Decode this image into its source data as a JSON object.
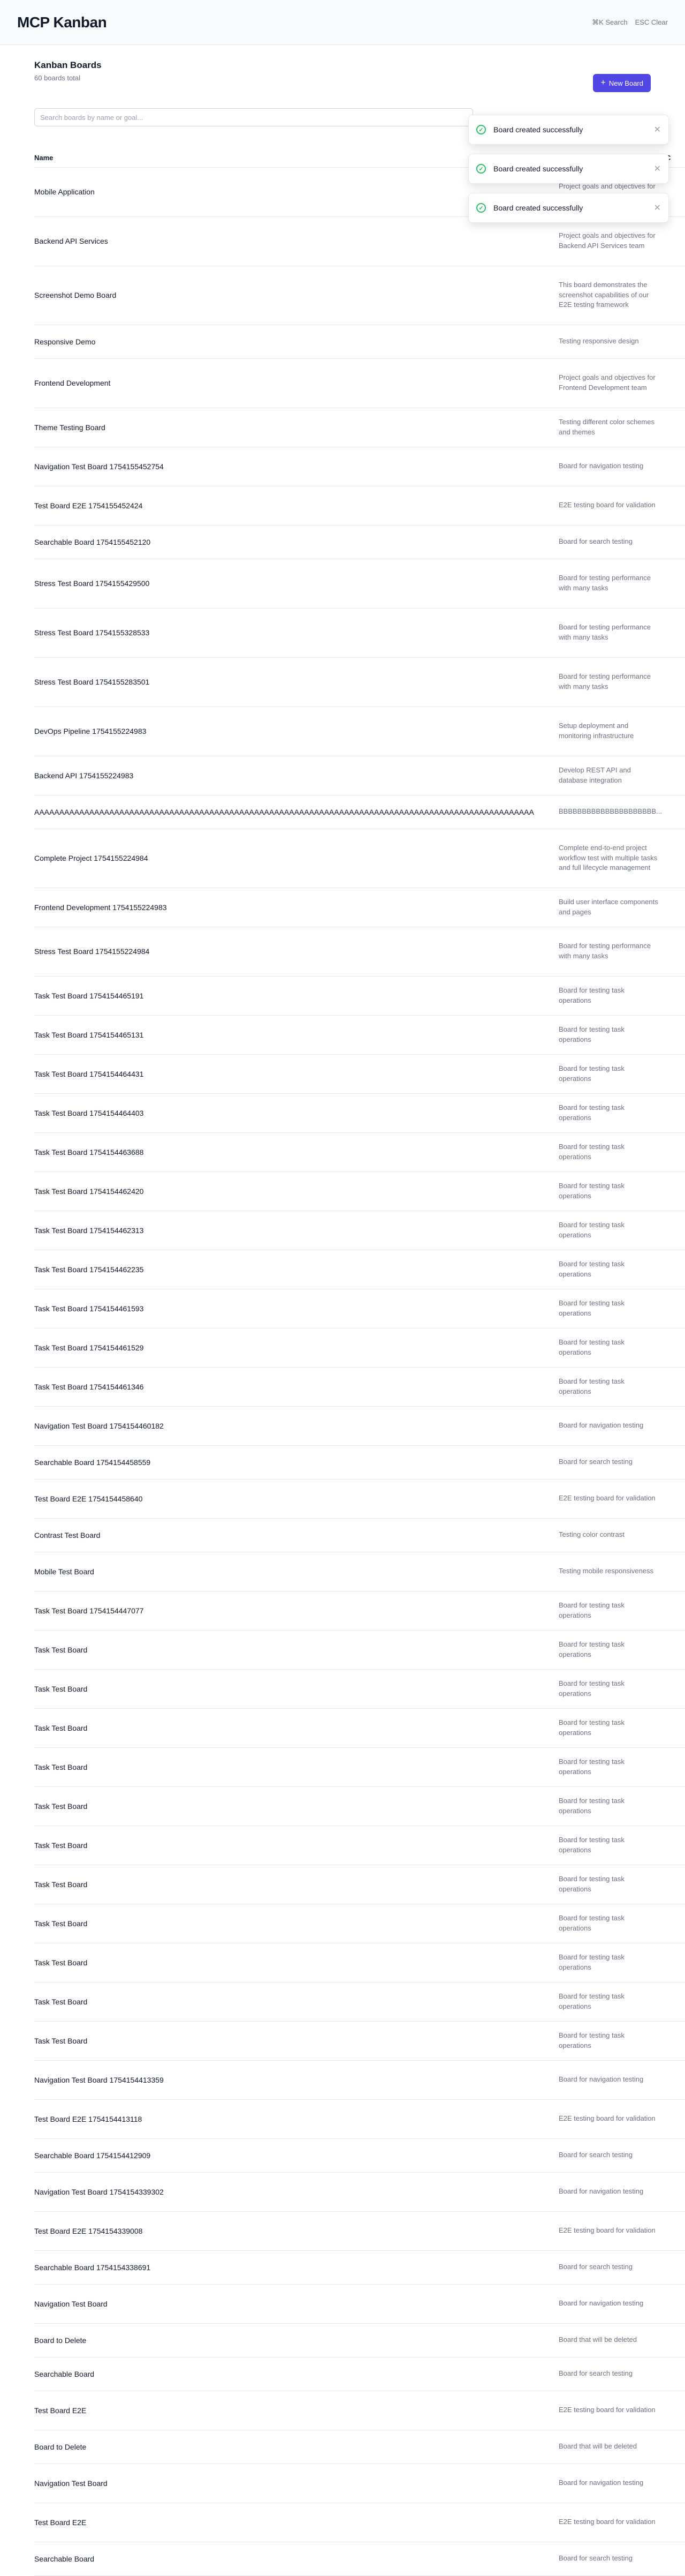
{
  "header": {
    "title": "MCP Kanban",
    "search_label": "⌘K Search",
    "clear_label": "ESC Clear"
  },
  "page": {
    "title": "Kanban Boards",
    "count": "60 boards total",
    "new_board_label": "New Board",
    "search_placeholder": "Search boards by name or goal..."
  },
  "table": {
    "col_name": "Name",
    "col_goal": "Goal",
    "col_extra": "C"
  },
  "toasts": [
    {
      "message": "Board created successfully"
    },
    {
      "message": "Board created successfully"
    },
    {
      "message": "Board created successfully"
    }
  ],
  "boards": [
    {
      "name": "Mobile Application",
      "goal": "Project goals and objectives for Mobile Application team"
    },
    {
      "name": "Backend API Services",
      "goal": "Project goals and objectives for Backend API Services team"
    },
    {
      "name": "Screenshot Demo Board",
      "goal": "This board demonstrates the screenshot capabilities of our E2E testing framework"
    },
    {
      "name": "Responsive Demo",
      "goal": "Testing responsive design"
    },
    {
      "name": "Frontend Development",
      "goal": "Project goals and objectives for Frontend Development team"
    },
    {
      "name": "Theme Testing Board",
      "goal": "Testing different color schemes and themes"
    },
    {
      "name": "Navigation Test Board 1754155452754",
      "goal": "Board for navigation testing"
    },
    {
      "name": "Test Board E2E 1754155452424",
      "goal": "E2E testing board for validation"
    },
    {
      "name": "Searchable Board 1754155452120",
      "goal": "Board for search testing"
    },
    {
      "name": "Stress Test Board 1754155429500",
      "goal": "Board for testing performance with many tasks"
    },
    {
      "name": "Stress Test Board 1754155328533",
      "goal": "Board for testing performance with many tasks"
    },
    {
      "name": "Stress Test Board 1754155283501",
      "goal": "Board for testing performance with many tasks"
    },
    {
      "name": "DevOps Pipeline 1754155224983",
      "goal": "Setup deployment and monitoring infrastructure"
    },
    {
      "name": "Backend API 1754155224983",
      "goal": "Develop REST API and database integration"
    },
    {
      "name": "AAAAAAAAAAAAAAAAAAAAAAAAAAAAAAAAAAAAAAAAAAAAAAAAAAAAAAAAAAAAAAAAAAAAAAAAAAAAAAAAAAAAAAAAAAAAAAAAAAAA",
      "goal": "BBBBBBBBBBBBBBBBBBBBB..."
    },
    {
      "name": "Complete Project 1754155224984",
      "goal": "Complete end-to-end project workflow test with multiple tasks and full lifecycle management"
    },
    {
      "name": "Frontend Development 1754155224983",
      "goal": "Build user interface components and pages"
    },
    {
      "name": "Stress Test Board 1754155224984",
      "goal": "Board for testing performance with many tasks"
    },
    {
      "name": "Task Test Board 1754154465191",
      "goal": "Board for testing task operations"
    },
    {
      "name": "Task Test Board 1754154465131",
      "goal": "Board for testing task operations"
    },
    {
      "name": "Task Test Board 1754154464431",
      "goal": "Board for testing task operations"
    },
    {
      "name": "Task Test Board 1754154464403",
      "goal": "Board for testing task operations"
    },
    {
      "name": "Task Test Board 1754154463688",
      "goal": "Board for testing task operations"
    },
    {
      "name": "Task Test Board 1754154462420",
      "goal": "Board for testing task operations"
    },
    {
      "name": "Task Test Board 1754154462313",
      "goal": "Board for testing task operations"
    },
    {
      "name": "Task Test Board 1754154462235",
      "goal": "Board for testing task operations"
    },
    {
      "name": "Task Test Board 1754154461593",
      "goal": "Board for testing task operations"
    },
    {
      "name": "Task Test Board 1754154461529",
      "goal": "Board for testing task operations"
    },
    {
      "name": "Task Test Board 1754154461346",
      "goal": "Board for testing task operations"
    },
    {
      "name": "Navigation Test Board 1754154460182",
      "goal": "Board for navigation testing"
    },
    {
      "name": "Searchable Board 1754154458559",
      "goal": "Board for search testing"
    },
    {
      "name": "Test Board E2E 1754154458640",
      "goal": "E2E testing board for validation"
    },
    {
      "name": "Contrast Test Board",
      "goal": "Testing color contrast"
    },
    {
      "name": "Mobile Test Board",
      "goal": "Testing mobile responsiveness"
    },
    {
      "name": "Task Test Board 1754154447077",
      "goal": "Board for testing task operations"
    },
    {
      "name": "Task Test Board",
      "goal": "Board for testing task operations"
    },
    {
      "name": "Task Test Board",
      "goal": "Board for testing task operations"
    },
    {
      "name": "Task Test Board",
      "goal": "Board for testing task operations"
    },
    {
      "name": "Task Test Board",
      "goal": "Board for testing task operations"
    },
    {
      "name": "Task Test Board",
      "goal": "Board for testing task operations"
    },
    {
      "name": "Task Test Board",
      "goal": "Board for testing task operations"
    },
    {
      "name": "Task Test Board",
      "goal": "Board for testing task operations"
    },
    {
      "name": "Task Test Board",
      "goal": "Board for testing task operations"
    },
    {
      "name": "Task Test Board",
      "goal": "Board for testing task operations"
    },
    {
      "name": "Task Test Board",
      "goal": "Board for testing task operations"
    },
    {
      "name": "Task Test Board",
      "goal": "Board for testing task operations"
    },
    {
      "name": "Navigation Test Board 1754154413359",
      "goal": "Board for navigation testing"
    },
    {
      "name": "Test Board E2E 1754154413118",
      "goal": "E2E testing board for validation"
    },
    {
      "name": "Searchable Board 1754154412909",
      "goal": "Board for search testing"
    },
    {
      "name": "Navigation Test Board 1754154339302",
      "goal": "Board for navigation testing"
    },
    {
      "name": "Test Board E2E 1754154339008",
      "goal": "E2E testing board for validation"
    },
    {
      "name": "Searchable Board 1754154338691",
      "goal": "Board for search testing"
    },
    {
      "name": "Navigation Test Board",
      "goal": "Board for navigation testing"
    },
    {
      "name": "Board to Delete",
      "goal": "Board that will be deleted"
    },
    {
      "name": "Searchable Board",
      "goal": "Board for search testing"
    },
    {
      "name": "Test Board E2E",
      "goal": "E2E testing board for validation"
    },
    {
      "name": "Board to Delete",
      "goal": "Board that will be deleted"
    },
    {
      "name": "Navigation Test Board",
      "goal": "Board for navigation testing"
    },
    {
      "name": "Test Board E2E",
      "goal": "E2E testing board for validation"
    },
    {
      "name": "Searchable Board",
      "goal": "Board for search testing"
    }
  ]
}
